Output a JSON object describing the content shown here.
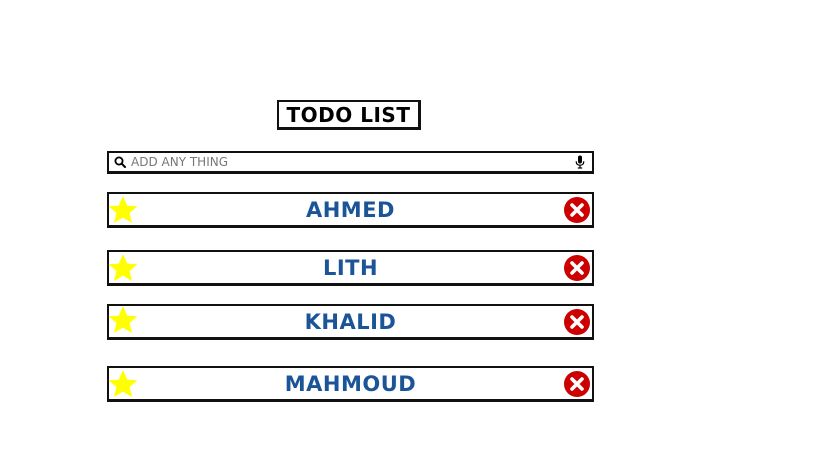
{
  "header": {
    "title": "TODO LIST"
  },
  "search": {
    "placeholder": "ADD ANY THING",
    "value": "",
    "search_icon": "search-icon",
    "mic_icon": "microphone-icon"
  },
  "todos": [
    {
      "label": "AHMED"
    },
    {
      "label": "LITH"
    },
    {
      "label": "KHALID"
    },
    {
      "label": "MAHMOUD"
    }
  ],
  "colors": {
    "label": "#1b5597",
    "star": "#ffff00",
    "delete": "#cc0000"
  }
}
